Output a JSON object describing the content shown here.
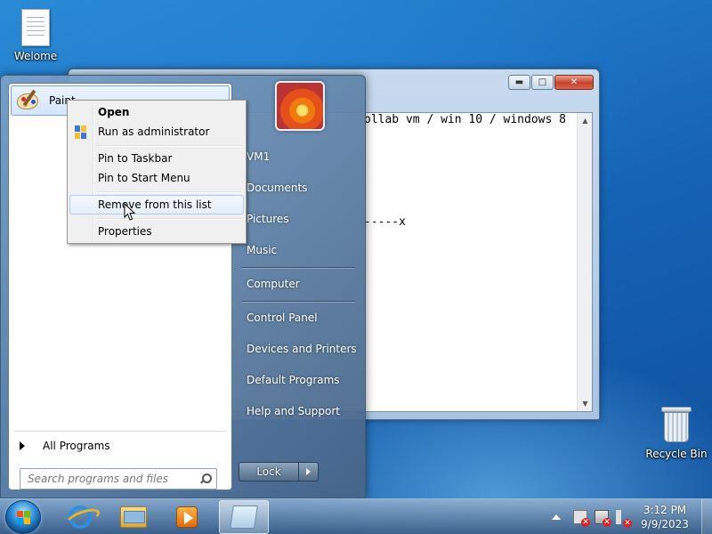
{
  "desktop": {
    "icons": [
      {
        "label": "Welome",
        "icon": "text-document-icon"
      },
      {
        "label": "Recycle Bin",
        "icon": "recycle-bin-icon"
      }
    ]
  },
  "notepad": {
    "line1": "ollab vm / win 10 / windows 8",
    "line2": "-----x"
  },
  "start_menu": {
    "pinned": {
      "label": "Paint",
      "icon": "paint-icon"
    },
    "all_programs": "All Programs",
    "search_placeholder": "Search programs and files",
    "right_items": [
      "VM1",
      "Documents",
      "Pictures",
      "Music",
      "Computer",
      "Control Panel",
      "Devices and Printers",
      "Default Programs",
      "Help and Support"
    ],
    "lock_label": "Lock"
  },
  "context_menu": {
    "items": [
      "Open",
      "Run as administrator",
      "Pin to Taskbar",
      "Pin to Start Menu",
      "Remove from this list",
      "Properties"
    ]
  },
  "taskbar": {
    "apps": [
      "internet-explorer-icon",
      "windows-explorer-icon",
      "media-player-icon",
      "notepad-icon"
    ],
    "time": "3:12 PM",
    "date": "9/9/2023"
  }
}
